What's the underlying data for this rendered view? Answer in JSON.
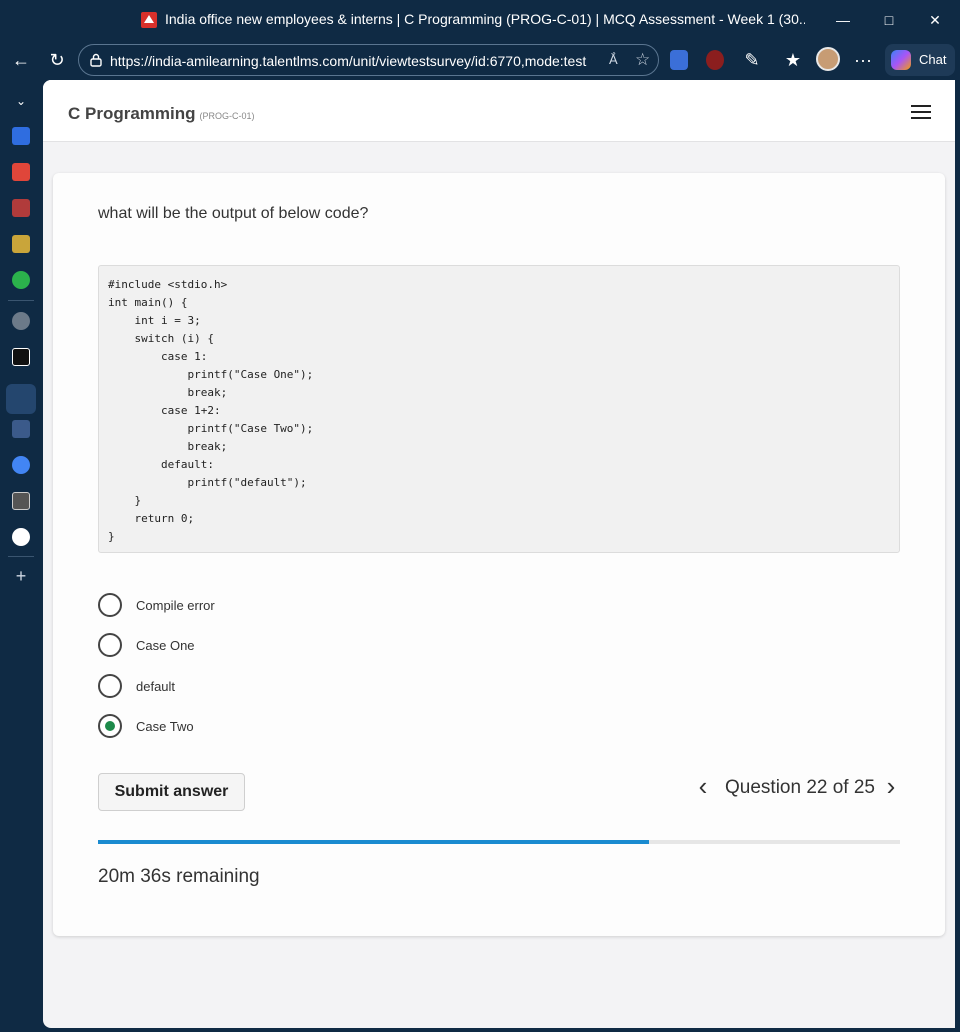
{
  "browser": {
    "title": "India office new employees & interns | C Programming (PROG-C-01) | MCQ Assessment - Week 1 (30...",
    "url": "https://india-amilearning.talentlms.com/unit/viewtestsurvey/id:6770,mode:test",
    "chat_label": "Chat",
    "read_aloud": "Ắ",
    "more": "···"
  },
  "header": {
    "course_title": "C Programming",
    "course_code": "(PROG-C-01)"
  },
  "question": {
    "prompt": "what will be the output of below code?",
    "code": "#include <stdio.h>\nint main() {\n    int i = 3;\n    switch (i) {\n        case 1:\n            printf(\"Case One\");\n            break;\n        case 1+2:\n            printf(\"Case Two\");\n            break;\n        default:\n            printf(\"default\");\n    }\n    return 0;\n}",
    "options": [
      {
        "label": "Compile error",
        "selected": false
      },
      {
        "label": "Case One",
        "selected": false
      },
      {
        "label": "default",
        "selected": false
      },
      {
        "label": "Case Two",
        "selected": true
      }
    ]
  },
  "footer": {
    "submit_label": "Submit answer",
    "question_nav": "Question 22 of 25",
    "progress": 0.687,
    "remaining": "20m 36s remaining"
  },
  "colors": {
    "chrome": "#0f2a44",
    "progress": "#1a8bd0",
    "selected_radio": "#1d8a4a"
  }
}
